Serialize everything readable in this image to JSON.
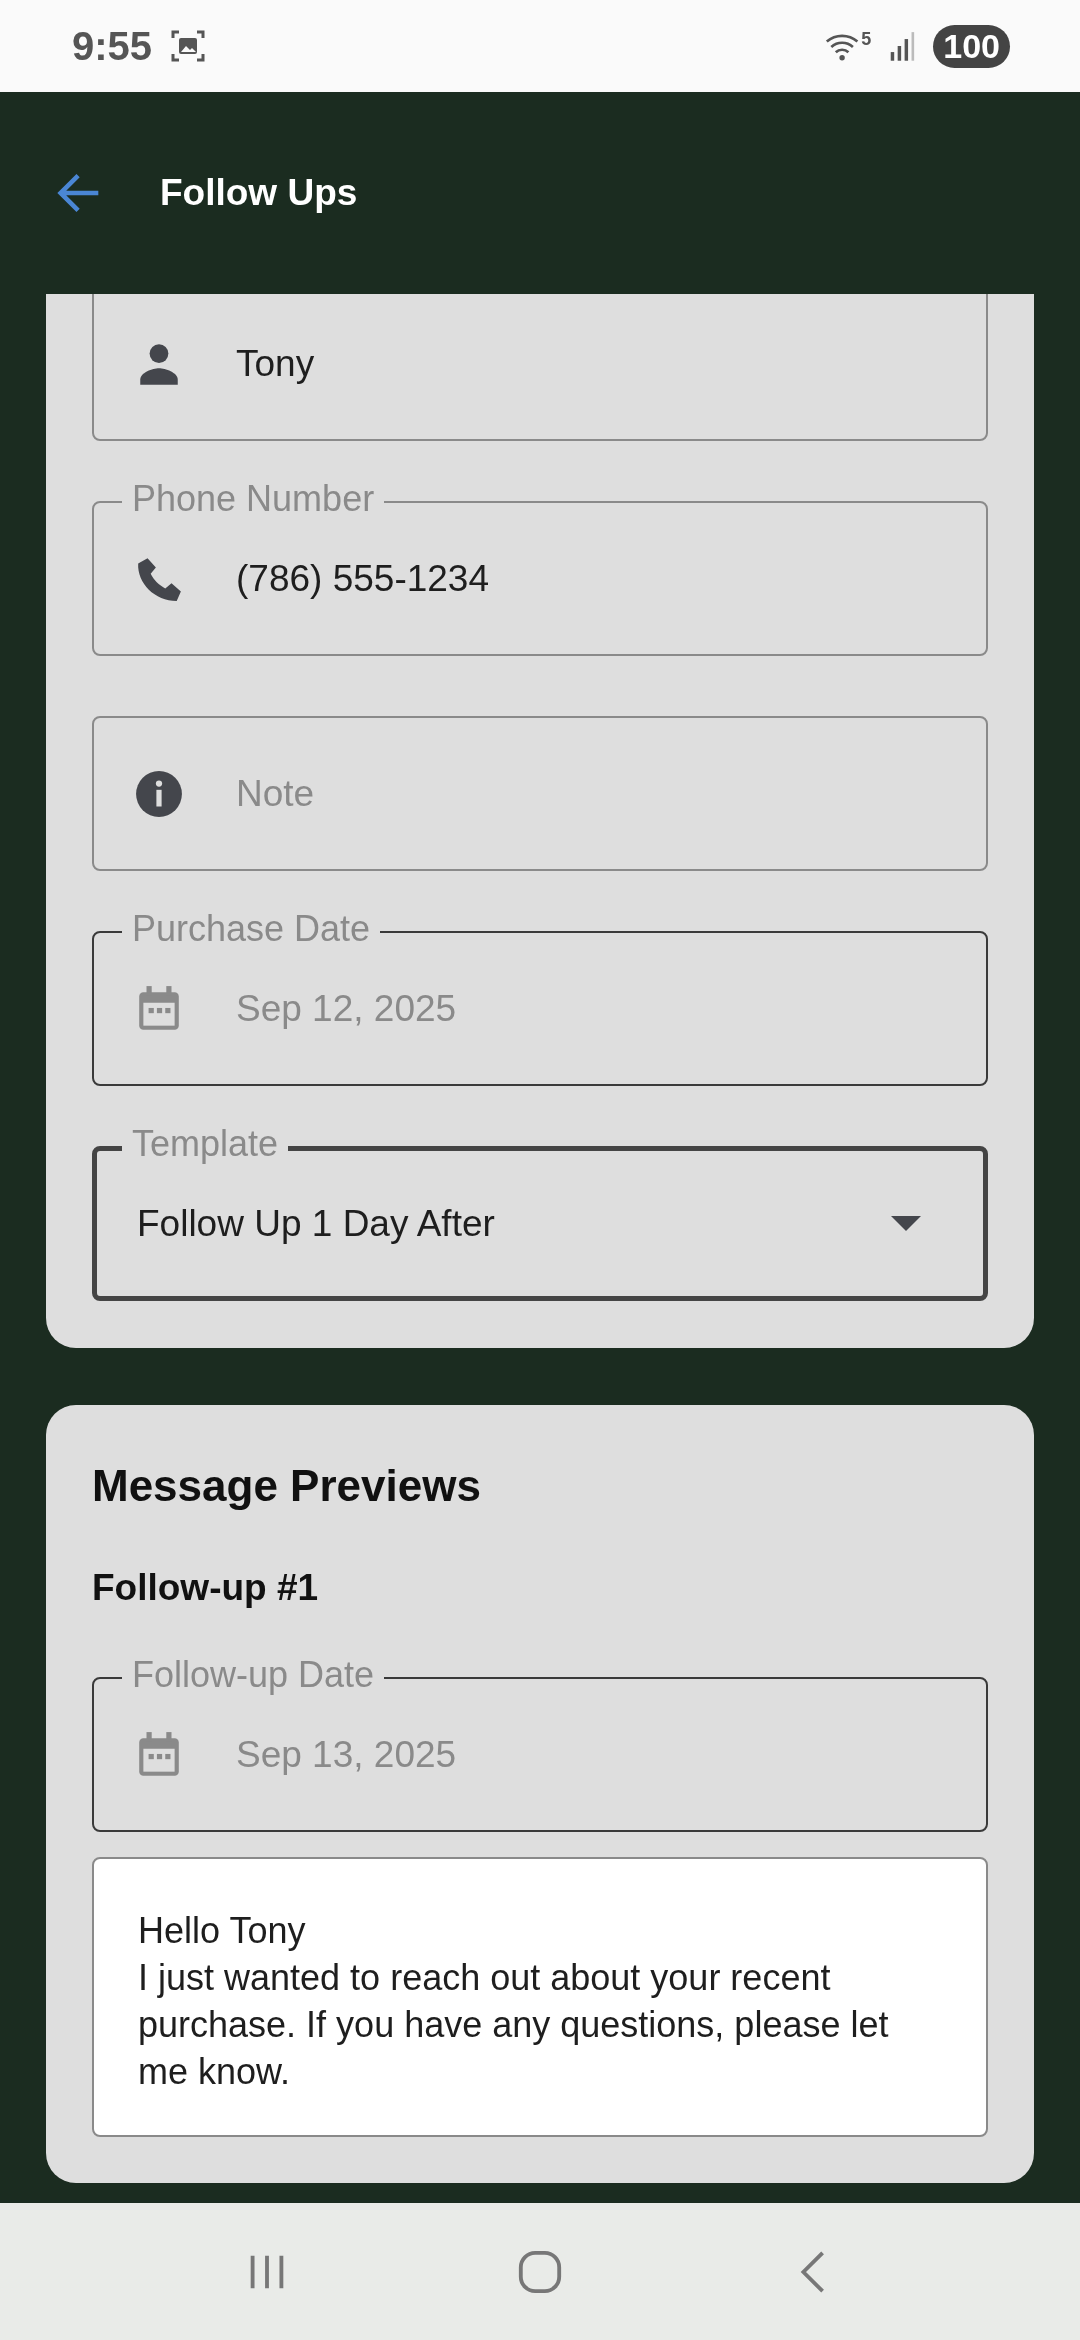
{
  "status_bar": {
    "time": "9:55",
    "network": "5",
    "battery": "100"
  },
  "app_bar": {
    "title": "Follow Ups"
  },
  "form_fields": [
    {
      "kind": "name",
      "value": "Tony",
      "disabled": false,
      "focused": false
    },
    {
      "kind": "phone",
      "label": "Phone Number",
      "value": "(786) 555-1234",
      "disabled": false,
      "focused": false
    },
    {
      "kind": "note",
      "placeholder": "Note",
      "disabled": false,
      "focused": false
    },
    {
      "kind": "date",
      "label": "Purchase Date",
      "value": "Sep 12, 2025",
      "disabled": true,
      "focused": false
    },
    {
      "kind": "dropdown",
      "label": "Template",
      "value": "Follow Up 1 Day After",
      "disabled": false,
      "focused": true
    }
  ],
  "message_previews": {
    "title": "Message Previews",
    "items": [
      {
        "heading": "Follow-up #1",
        "date_field": {
          "kind": "date",
          "label": "Follow-up Date",
          "value": "Sep 13, 2025",
          "disabled": true,
          "focused": false
        },
        "message": "Hello Tony\nI just wanted to reach out about your recent purchase. If you have any questions, please let me know."
      }
    ]
  }
}
